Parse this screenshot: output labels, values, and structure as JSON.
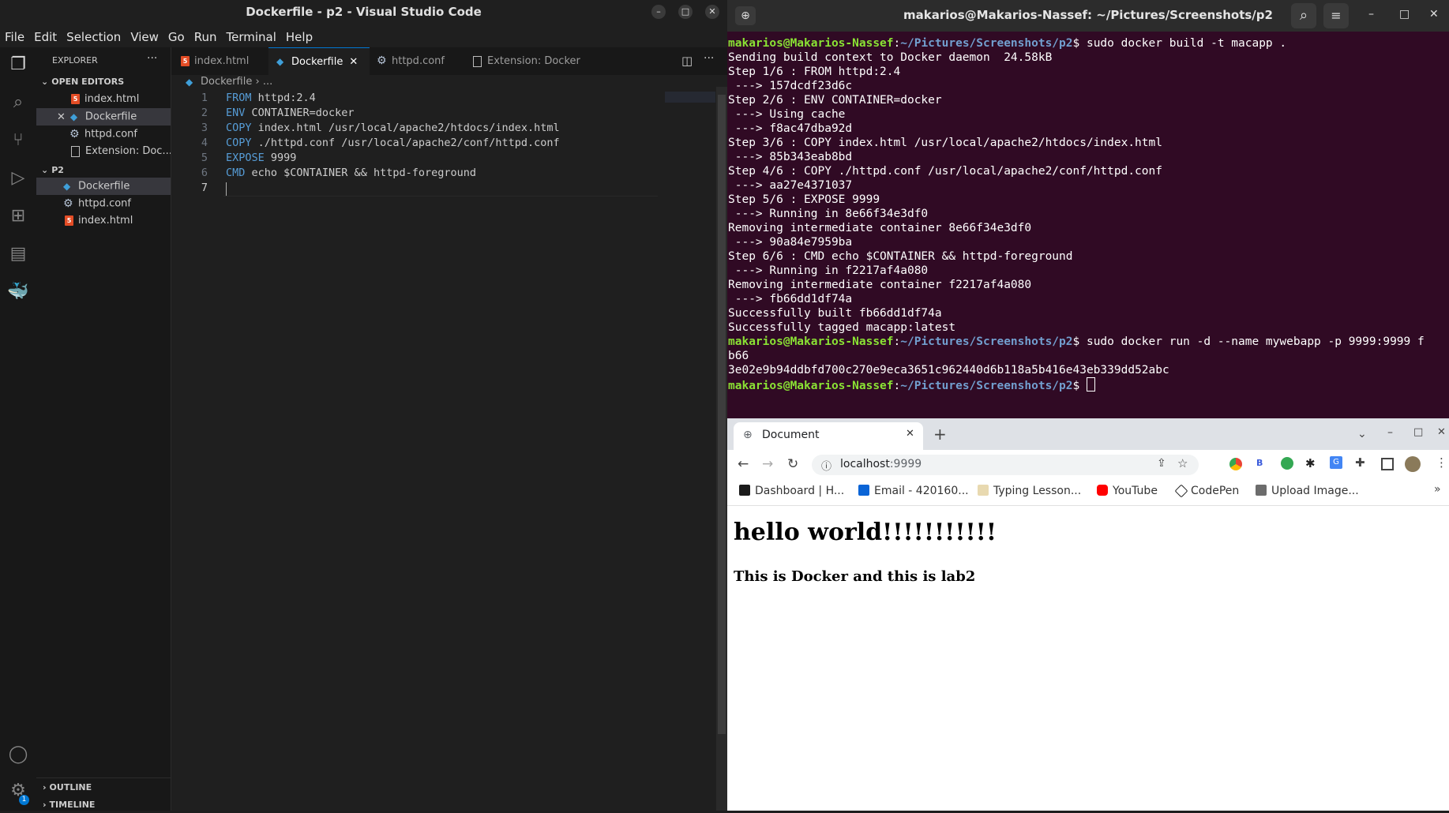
{
  "vscode": {
    "window_title": "Dockerfile - p2 - Visual Studio Code",
    "menu": [
      "File",
      "Edit",
      "Selection",
      "View",
      "Go",
      "Run",
      "Terminal",
      "Help"
    ],
    "explorer_label": "EXPLORER",
    "open_editors_label": "OPEN EDITORS",
    "open_editors": [
      "index.html",
      "Dockerfile",
      "httpd.conf",
      "Extension: Doc..."
    ],
    "folder_label": "P2",
    "folder_files": [
      "Dockerfile",
      "httpd.conf",
      "index.html"
    ],
    "outline_label": "OUTLINE",
    "timeline_label": "TIMELINE",
    "tabs": [
      "index.html",
      "Dockerfile",
      "httpd.conf",
      "Extension: Docker"
    ],
    "breadcrumb_file": "Dockerfile",
    "breadcrumb_more": "...",
    "settings_badge": "1",
    "code": [
      {
        "n": "1",
        "kw": "FROM",
        "rest": " httpd:2.4"
      },
      {
        "n": "2",
        "kw": "ENV",
        "rest": " CONTAINER=docker"
      },
      {
        "n": "3",
        "kw": "COPY",
        "rest": " index.html /usr/local/apache2/htdocs/index.html"
      },
      {
        "n": "4",
        "kw": "COPY",
        "rest": " ./httpd.conf /usr/local/apache2/conf/httpd.conf"
      },
      {
        "n": "5",
        "kw": "EXPOSE",
        "rest": " 9999"
      },
      {
        "n": "6",
        "kw": "CMD",
        "rest": " echo $CONTAINER && httpd-foreground"
      },
      {
        "n": "7",
        "kw": "",
        "rest": ""
      }
    ]
  },
  "terminal": {
    "title": "makarios@Makarios-Nassef: ~/Pictures/Screenshots/p2",
    "user": "makarios@Makarios-Nassef",
    "path": "~/Pictures/Screenshots/p2",
    "cmd1": " sudo docker build -t macapp .",
    "output": [
      "Sending build context to Docker daemon  24.58kB",
      "Step 1/6 : FROM httpd:2.4",
      " ---> 157dcdf23d6c",
      "Step 2/6 : ENV CONTAINER=docker",
      " ---> Using cache",
      " ---> f8ac47dba92d",
      "Step 3/6 : COPY index.html /usr/local/apache2/htdocs/index.html",
      " ---> 85b343eab8bd",
      "Step 4/6 : COPY ./httpd.conf /usr/local/apache2/conf/httpd.conf",
      " ---> aa27e4371037",
      "Step 5/6 : EXPOSE 9999",
      " ---> Running in 8e66f34e3df0",
      "Removing intermediate container 8e66f34e3df0",
      " ---> 90a84e7959ba",
      "Step 6/6 : CMD echo $CONTAINER && httpd-foreground",
      " ---> Running in f2217af4a080",
      "Removing intermediate container f2217af4a080",
      " ---> fb66dd1df74a",
      "Successfully built fb66dd1df74a",
      "Successfully tagged macapp:latest"
    ],
    "cmd2": " sudo docker run -d --name mywebapp -p 9999:9999 f",
    "cmd2_wrap": "b66",
    "container_id": "3e02e9b94ddbfd700c270e9eca3651c962440d6b118a5b416e43eb339dd52abc"
  },
  "browser": {
    "tab_title": "Document",
    "url_host": "localhost",
    "url_port": ":9999",
    "bookmarks": [
      "Dashboard | H...",
      "Email - 420160...",
      "Typing Lesson...",
      "YouTube",
      "CodePen",
      "Upload Image..."
    ],
    "heading": "hello world!!!!!!!!!!!",
    "subheading": "This is Docker and this is lab2"
  },
  "colors": {
    "terminal_bg": "#300a24",
    "prompt_user": "#8ae234",
    "prompt_path": "#729fcf",
    "vscode_keyword": "#569cd6",
    "accent": "#0078d4"
  }
}
